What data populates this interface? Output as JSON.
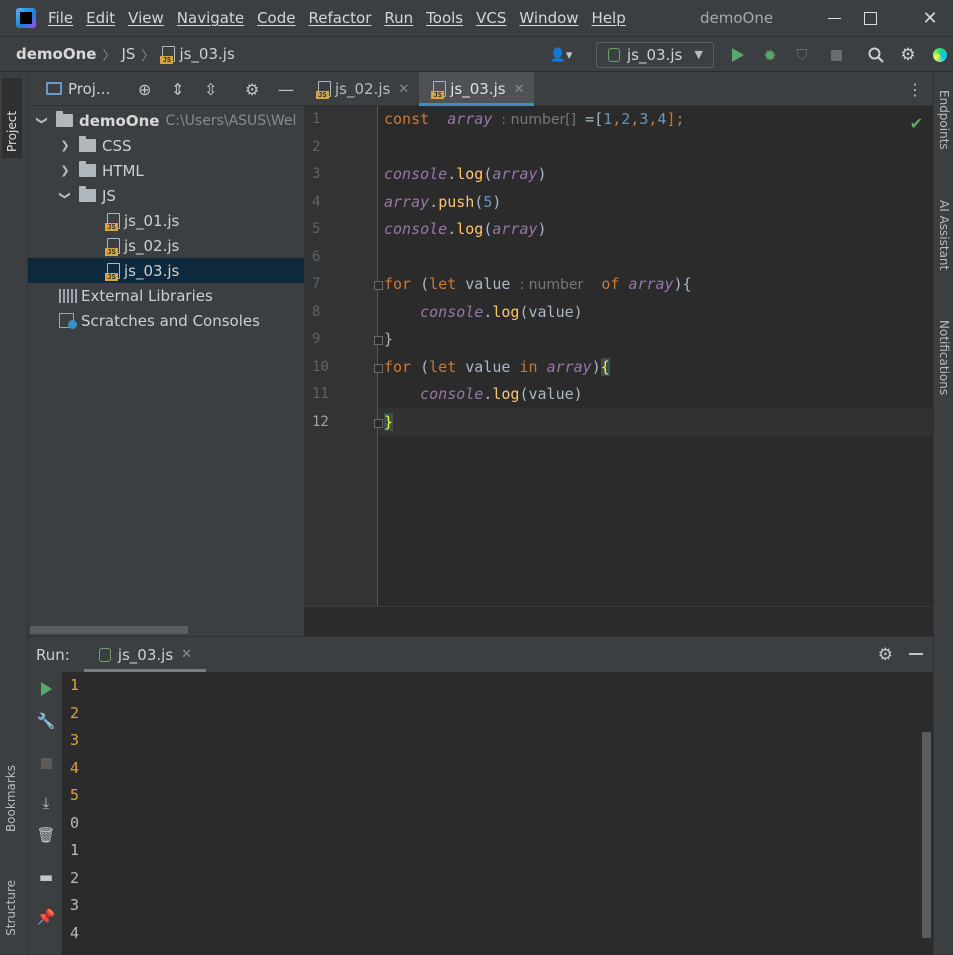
{
  "menu": {
    "items": [
      "File",
      "Edit",
      "View",
      "Navigate",
      "Code",
      "Refactor",
      "Run",
      "Tools",
      "VCS",
      "Window",
      "Help"
    ],
    "window_title": "demoOne"
  },
  "navbar": {
    "breadcrumb": [
      "demoOne",
      "JS",
      "js_03.js"
    ],
    "run_config": "js_03.js"
  },
  "left_strip": {
    "project": "Project",
    "bookmarks": "Bookmarks",
    "structure": "Structure"
  },
  "project_panel": {
    "title": "Proj...",
    "tree": [
      {
        "label": "demoOne",
        "path": "C:\\Users\\ASUS\\Wel",
        "type": "folder",
        "level": 0,
        "expanded": true
      },
      {
        "label": "CSS",
        "type": "folder",
        "level": 1,
        "expanded": false
      },
      {
        "label": "HTML",
        "type": "folder",
        "level": 1,
        "expanded": false
      },
      {
        "label": "JS",
        "type": "folder",
        "level": 1,
        "expanded": true
      },
      {
        "label": "js_01.js",
        "type": "js-file",
        "level": 2
      },
      {
        "label": "js_02.js",
        "type": "js-file",
        "level": 2
      },
      {
        "label": "js_03.js",
        "type": "js-file",
        "level": 2,
        "selected": true
      },
      {
        "label": "External Libraries",
        "type": "libraries",
        "level": 0
      },
      {
        "label": "Scratches and Consoles",
        "type": "scratches",
        "level": 0
      }
    ]
  },
  "editor": {
    "tabs": [
      {
        "label": "js_02.js",
        "active": false
      },
      {
        "label": "js_03.js",
        "active": true
      }
    ],
    "line_numbers": [
      "1",
      "2",
      "3",
      "4",
      "5",
      "6",
      "7",
      "8",
      "9",
      "10",
      "11",
      "12"
    ],
    "code": {
      "l1_kw": "const",
      "l1_var": "array",
      "l1_hint": ": number[]",
      "l1_rest": "=[",
      "l1_nums": [
        "1",
        "2",
        "3",
        "4"
      ],
      "l1_end": "];",
      "l3_obj": "console",
      "l3_method": "log",
      "l3_arg": "array",
      "l4_obj": "array",
      "l4_method": "push",
      "l4_arg": "5",
      "l5_obj": "console",
      "l5_method": "log",
      "l5_arg": "array",
      "l7_kw1": "for",
      "l7_kw2": "let",
      "l7_var": "value",
      "l7_hint": ": number",
      "l7_kw3": "of",
      "l7_arr": "array",
      "l8_obj": "console",
      "l8_method": "log",
      "l8_arg": "value",
      "l9": "}",
      "l10_kw1": "for",
      "l10_kw2": "let",
      "l10_var": "value",
      "l10_kw3": "in",
      "l10_arr": "array",
      "l10_brace": "{",
      "l11_obj": "console",
      "l11_method": "log",
      "l11_arg": "value",
      "l12": "}"
    }
  },
  "right_strip": {
    "endpoints": "Endpoints",
    "ai": "AI Assistant",
    "notifications": "Notifications"
  },
  "run_panel": {
    "label": "Run:",
    "tab": "js_03.js",
    "output": [
      "1",
      "2",
      "3",
      "4",
      "5",
      "0",
      "1",
      "2",
      "3",
      "4"
    ]
  },
  "colors": {
    "accent": "#4a88c7",
    "run_green": "#59a869",
    "selection": "#0d293e",
    "output_number": "#d9a343"
  }
}
